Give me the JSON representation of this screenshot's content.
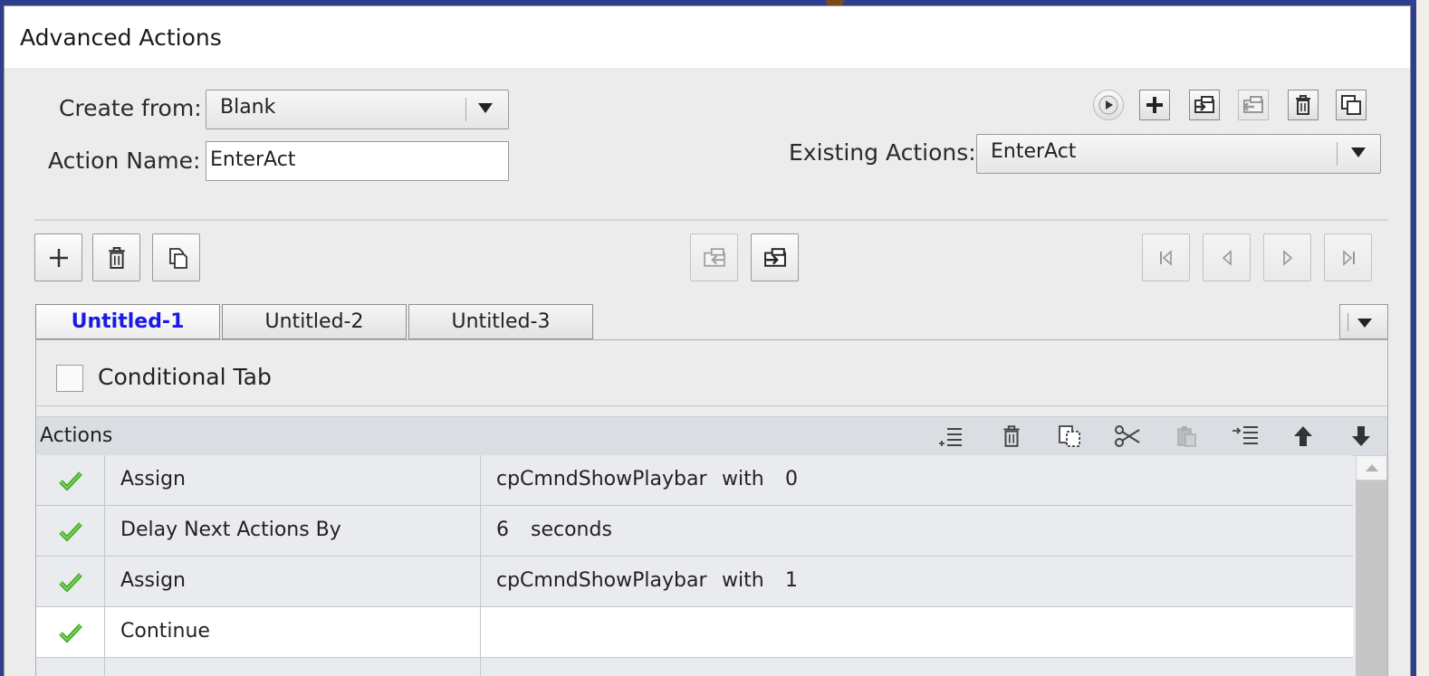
{
  "window": {
    "title": "Advanced Actions"
  },
  "form": {
    "create_from_label": "Create from:",
    "create_from_value": "Blank",
    "action_name_label": "Action Name:",
    "action_name_value": "EnterAct",
    "existing_actions_label": "Existing Actions:",
    "existing_actions_value": "EnterAct"
  },
  "tabs": [
    {
      "label": "Untitled-1",
      "active": true
    },
    {
      "label": "Untitled-2",
      "active": false
    },
    {
      "label": "Untitled-3",
      "active": false
    }
  ],
  "conditional": {
    "label": "Conditional Tab",
    "checked": false
  },
  "actions": {
    "header": "Actions",
    "columns_note": "",
    "rows": [
      {
        "status": "check-icon",
        "action": "Assign",
        "target": "cpCmndShowPlaybar",
        "op": "with",
        "value": "0"
      },
      {
        "status": "check-icon",
        "action": "Delay Next Actions By",
        "target": "6",
        "op": "seconds",
        "value": ""
      },
      {
        "status": "check-icon",
        "action": "Assign",
        "target": "cpCmndShowPlaybar",
        "op": "with",
        "value": "1"
      },
      {
        "status": "check-icon",
        "action": "Continue",
        "target": "",
        "op": "",
        "value": ""
      }
    ]
  },
  "colors": {
    "active_tab": "#1a1ae8",
    "check": "#3aa821",
    "header_bg": "#dadee2"
  }
}
